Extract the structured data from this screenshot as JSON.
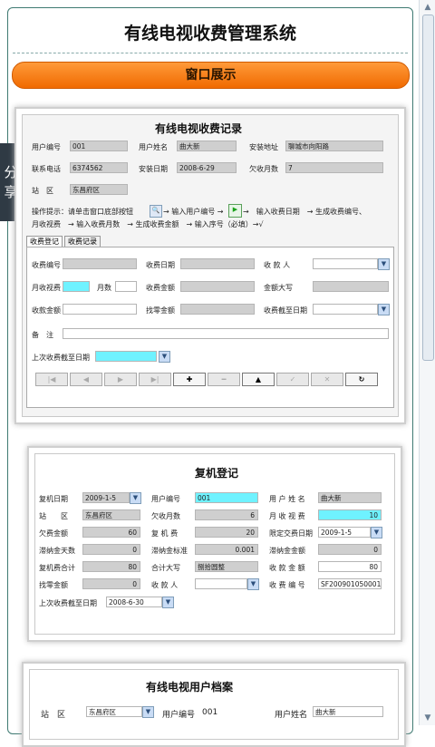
{
  "app_title": "有线电视收费管理系统",
  "section_button": "窗口展示",
  "share": [
    "分",
    "享"
  ],
  "shot1": {
    "title": "有线电视收费记录",
    "labels": {
      "user_id": "用户编号",
      "user_name": "用户姓名",
      "address": "安装地址",
      "phone": "联系电话",
      "install_date": "安装日期",
      "owed_months": "欠收月数",
      "station": "站　区"
    },
    "values": {
      "user_id": "001",
      "user_name": "曲大新",
      "address": "聊城市向阳路",
      "phone": "6374562",
      "install_date": "2008-6-29",
      "owed_months": "7",
      "station": "东昌府区"
    },
    "hint1_a": "操作提示：请单击窗口底部按钮",
    "hint1_b": "→ 输入用户编号 →",
    "hint1_c": "→　输入收费日期　→ 生成收费编号、",
    "hint2": "月收视费　→ 输入收费月数　→ 生成收费金额　→ 输入序号（必填）→√",
    "tab1": "收费登记",
    "tab2": "收费记录",
    "form": {
      "fee_id": "收费编号",
      "fee_date": "收费日期",
      "payee": "收 款 人",
      "monthly": "月收视费",
      "months": "月数",
      "amount": "收费金额",
      "amount_cn": "金额大写",
      "received": "收款金额",
      "change": "找零金额",
      "until": "收费截至日期",
      "note": "备　注",
      "last_until": "上次收费截至日期"
    },
    "nav": [
      "|◀",
      "◀",
      "▶",
      "▶|",
      "✚",
      "━",
      "▲",
      "✓",
      "✕",
      "↻"
    ]
  },
  "shot2": {
    "title": "复机登记",
    "rows": [
      [
        {
          "l": "复机日期",
          "v": "2009-1-5",
          "dd": true
        },
        {
          "l": "用户编号",
          "v": "001",
          "cy": true
        },
        {
          "l": "用 户 姓 名",
          "v": "曲大新"
        }
      ],
      [
        {
          "l": "站　　区",
          "v": "东昌府区"
        },
        {
          "l": "欠收月数",
          "v": "6",
          "r": true
        },
        {
          "l": "月 收 视 费",
          "v": "10",
          "r": true,
          "cy": true
        }
      ],
      [
        {
          "l": "欠费金额",
          "v": "60",
          "r": true
        },
        {
          "l": "复 机 费",
          "v": "20",
          "r": true
        },
        {
          "l": "限定交费日期",
          "v": "2009-1-5",
          "dd": true,
          "w": true
        }
      ],
      [
        {
          "l": "滞纳金天数",
          "v": "0",
          "r": true
        },
        {
          "l": "滞纳金标准",
          "v": "0.001",
          "r": true
        },
        {
          "l": "滞纳金金额",
          "v": "0",
          "r": true
        }
      ],
      [
        {
          "l": "复机费合计",
          "v": "80",
          "r": true
        },
        {
          "l": "合计大写",
          "v": "捌拾圆整"
        },
        {
          "l": "收 款 金 额",
          "v": "80",
          "r": true,
          "w": true
        }
      ],
      [
        {
          "l": "找零金额",
          "v": "0",
          "r": true
        },
        {
          "l": "收 款 人",
          "v": "",
          "dd": true,
          "w": true
        },
        {
          "l": "收 费 编 号",
          "v": "SF200901050001",
          "w": true
        }
      ]
    ],
    "last_label": "上次收费截至日期",
    "last_value": "2008-6-30"
  },
  "shot3": {
    "title": "有线电视用户档案",
    "station_label": "站　区",
    "station_value": "东昌府区",
    "uid_label": "用户编号",
    "uid_value": "001",
    "name_label": "用户姓名",
    "name_value": "曲大新"
  }
}
